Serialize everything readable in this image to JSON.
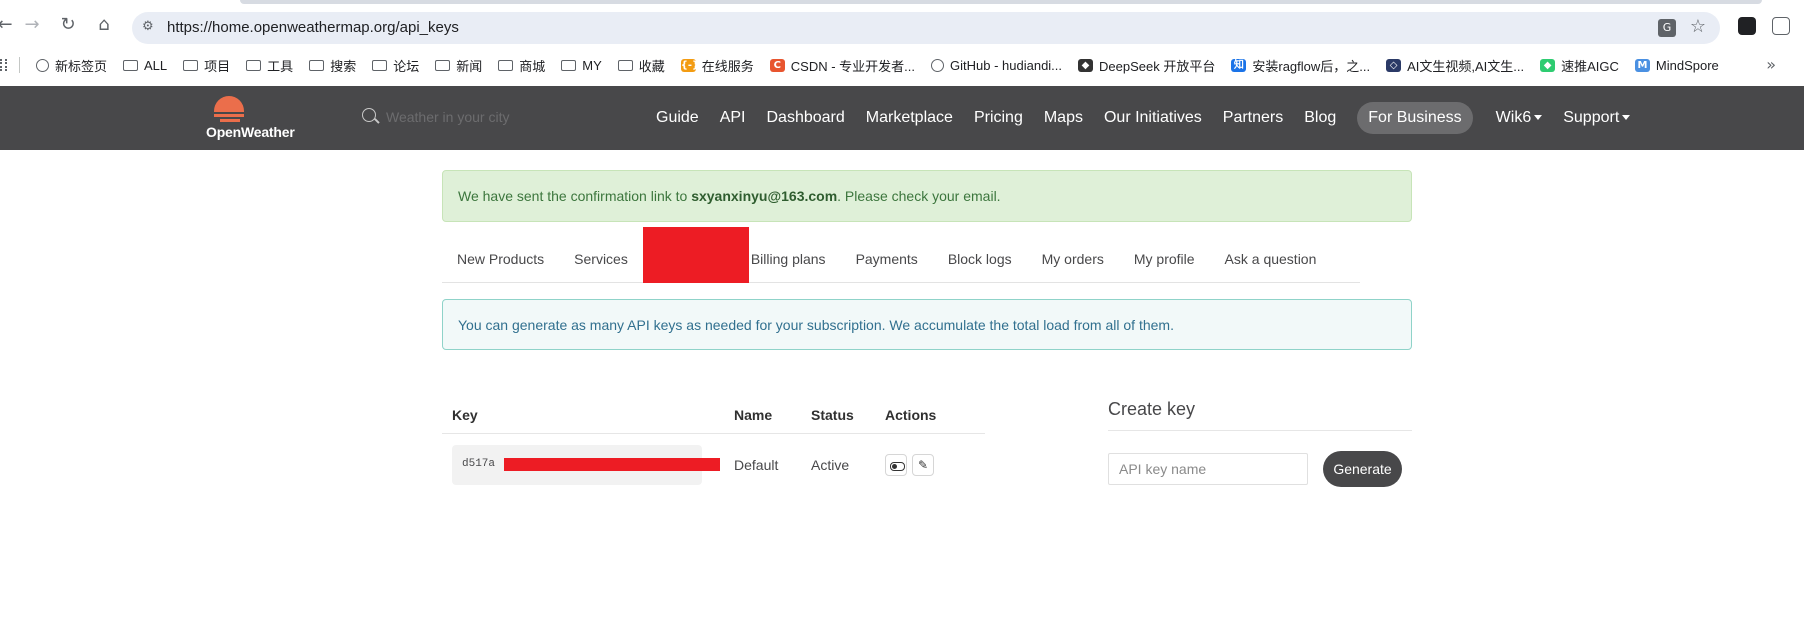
{
  "browser": {
    "url": "https://home.openweathermap.org/api_keys",
    "back_icon": "arrow-left",
    "forward_icon": "arrow-right",
    "reload_icon": "reload",
    "home_icon": "home"
  },
  "bookmarks": [
    {
      "label": "新标签页",
      "icon": "globe"
    },
    {
      "label": "ALL",
      "icon": "folder"
    },
    {
      "label": "项目",
      "icon": "folder"
    },
    {
      "label": "工具",
      "icon": "folder"
    },
    {
      "label": "搜索",
      "icon": "folder"
    },
    {
      "label": "论坛",
      "icon": "folder"
    },
    {
      "label": "新闻",
      "icon": "folder"
    },
    {
      "label": "商城",
      "icon": "folder"
    },
    {
      "label": "MY",
      "icon": "folder"
    },
    {
      "label": "收藏",
      "icon": "folder"
    },
    {
      "label": "在线服务",
      "icon": "badge",
      "color": "#f39c12",
      "glyph": "{-}"
    },
    {
      "label": "CSDN - 专业开发者...",
      "icon": "badge",
      "color": "#e8552f",
      "glyph": "C"
    },
    {
      "label": "GitHub - hudiandi...",
      "icon": "globe"
    },
    {
      "label": "DeepSeek 开放平台",
      "icon": "badge",
      "color": "#333333",
      "glyph": "◆"
    },
    {
      "label": "安装ragflow后，之...",
      "icon": "badge",
      "color": "#1a73e8",
      "glyph": "知"
    },
    {
      "label": "AI文生视频,AI文生...",
      "icon": "badge",
      "color": "#2b3a67",
      "glyph": "◇"
    },
    {
      "label": "速推AIGC",
      "icon": "badge",
      "color": "#2ecc71",
      "glyph": "◆"
    },
    {
      "label": "MindSpore",
      "icon": "badge",
      "color": "#4a90e2",
      "glyph": "M"
    }
  ],
  "owm": {
    "logo_text": "OpenWeather",
    "search_placeholder": "Weather in your city",
    "nav": [
      "Guide",
      "API",
      "Dashboard",
      "Marketplace",
      "Pricing",
      "Maps",
      "Our Initiatives",
      "Partners",
      "Blog"
    ],
    "for_business": "For Business",
    "user": "Wik6",
    "support": "Support"
  },
  "alert": {
    "prefix": "We have sent the confirmation link to ",
    "email": "sxyanxinyu@163.com",
    "suffix": ". Please check your email."
  },
  "tabs": [
    "New Products",
    "Services",
    "Billing plans",
    "Payments",
    "Block logs",
    "My orders",
    "My profile",
    "Ask a question"
  ],
  "info": "You can generate as many API keys as needed for your subscription. We accumulate the total load from all of them.",
  "keys_table": {
    "headers": {
      "key": "Key",
      "name": "Name",
      "status": "Status",
      "actions": "Actions"
    },
    "rows": [
      {
        "key": "d517a",
        "name": "Default",
        "status": "Active"
      }
    ]
  },
  "create": {
    "title": "Create key",
    "placeholder": "API key name",
    "button": "Generate"
  },
  "colors": {
    "header_bg": "#48484a",
    "brand_orange": "#eb6e4b",
    "redaction": "#ed1c24"
  }
}
